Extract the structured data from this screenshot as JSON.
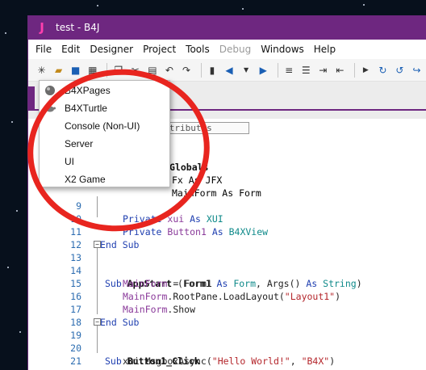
{
  "window": {
    "title": "test - B4J",
    "app_logo": "J"
  },
  "menubar": {
    "items": [
      {
        "label": "File",
        "enabled": true
      },
      {
        "label": "Edit",
        "enabled": true
      },
      {
        "label": "Designer",
        "enabled": true
      },
      {
        "label": "Project",
        "enabled": true
      },
      {
        "label": "Tools",
        "enabled": true
      },
      {
        "label": "Debug",
        "enabled": false
      },
      {
        "label": "Windows",
        "enabled": true
      },
      {
        "label": "Help",
        "enabled": true
      }
    ]
  },
  "toolbar": {
    "icons": [
      "new-project-icon",
      "open-folder-icon",
      "save-icon",
      "save-all-icon",
      "copy-icon",
      "cut-icon",
      "paste-icon",
      "undo-icon",
      "redo-icon",
      "bookmark-icon",
      "back-icon",
      "dropdown-icon",
      "forward-icon",
      "comment-icon",
      "uncomment-icon",
      "indent-icon",
      "outdent-icon",
      "run-icon",
      "step-icon",
      "step-in-icon",
      "step-out-icon"
    ]
  },
  "new_project_menu": {
    "items": [
      {
        "label": "B4XPages",
        "icon": "b4xpages-icon"
      },
      {
        "label": "B4XTurtle",
        "icon": "turtle-icon"
      },
      {
        "label": "Console (Non-UI)",
        "icon": ""
      },
      {
        "label": "Server",
        "icon": ""
      },
      {
        "label": "UI",
        "icon": ""
      },
      {
        "label": "X2 Game",
        "icon": ""
      }
    ]
  },
  "editor": {
    "attributes_partial": "ect Attributes",
    "line6_partial": "Globals",
    "line7_partial": "Fx As JFX",
    "line8_partial": "MainForm As Form",
    "lines": [
      {
        "n": "9",
        "text": "Private xui As XUI"
      },
      {
        "n": "10",
        "text": "Private Button1 As B4XView"
      },
      {
        "n": "11",
        "text": "End Sub"
      },
      {
        "n": "12",
        "text": ""
      },
      {
        "n": "13",
        "text": "Sub AppStart (Form1 As Form, Args() As String)"
      },
      {
        "n": "14",
        "text": "MainForm = Form1"
      },
      {
        "n": "15",
        "text": "MainForm.RootPane.LoadLayout(\"Layout1\")"
      },
      {
        "n": "16",
        "text": "MainForm.Show"
      },
      {
        "n": "17",
        "text": "End Sub"
      },
      {
        "n": "18",
        "text": ""
      },
      {
        "n": "19",
        "text": "Sub Button1_Click"
      },
      {
        "n": "20",
        "text": "xui.MsgboxAsync(\"Hello World!\", \"B4X\")"
      },
      {
        "n": "21",
        "text": "End Sub"
      }
    ]
  },
  "colors": {
    "titlebar": "#6e2780",
    "annotation": "#e8251f",
    "keyword": "#1f3fb0",
    "string": "#b4262b",
    "type": "#0f8a8a"
  }
}
